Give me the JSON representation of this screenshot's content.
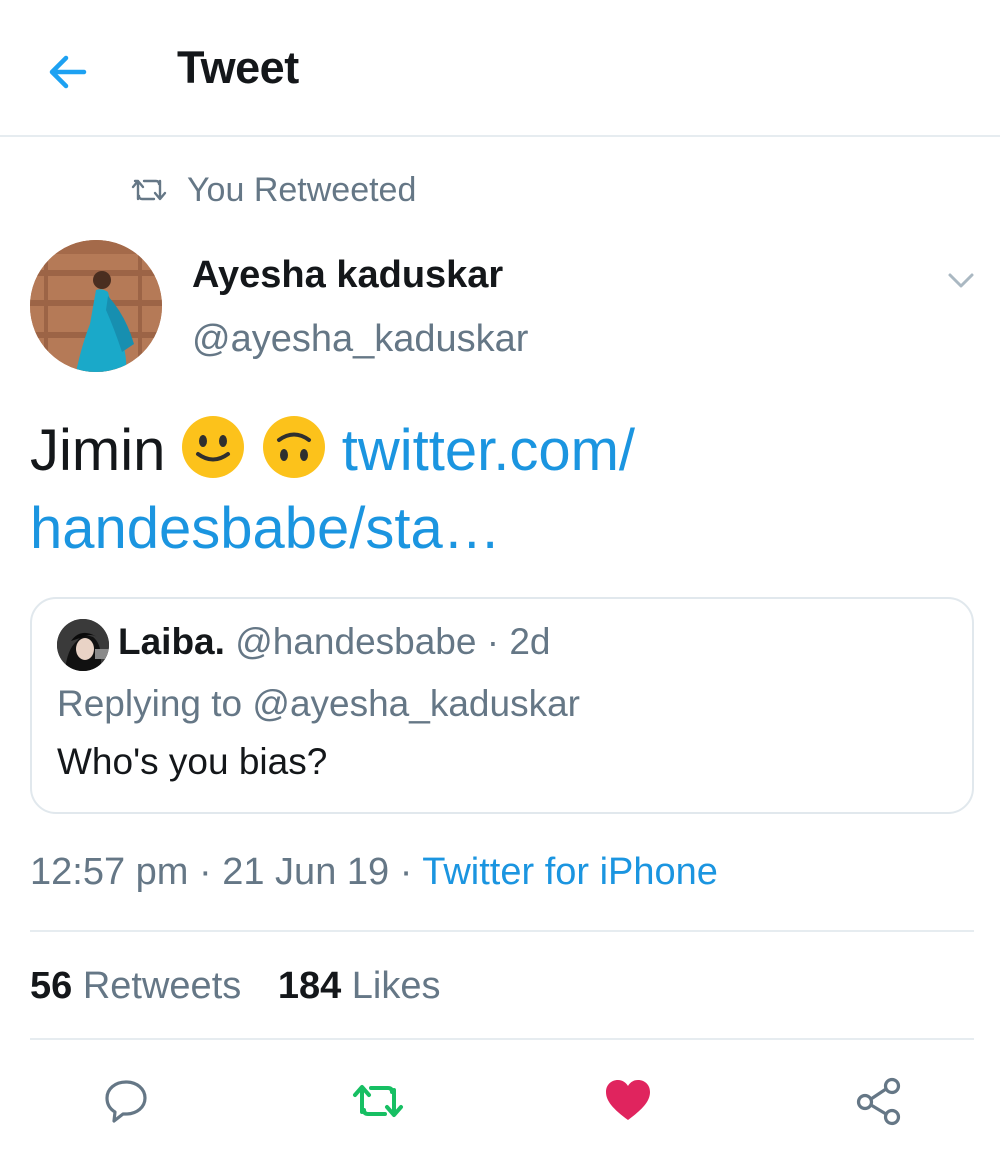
{
  "header": {
    "title": "Tweet",
    "back_icon": "arrow-left-icon"
  },
  "social_context": {
    "label": "You Retweeted",
    "icon": "retweet-icon"
  },
  "tweet": {
    "author_name": "Ayesha kaduskar",
    "author_handle": "@ayesha_kaduskar",
    "text": "Jimin",
    "emojis": [
      "slightly-smiling-face-icon",
      "upside-down-face-icon"
    ],
    "link_line1": "twitter.com/",
    "link_line2": "handesbabe/sta…",
    "timestamp": "12:57 pm",
    "date": "21 Jun 19",
    "source": "Twitter for iPhone"
  },
  "quote": {
    "name": "Laiba.",
    "handle": "@handesbabe",
    "age": "2d",
    "replying_prefix": "Replying to",
    "replying_to": "@ayesha_kaduskar",
    "text": "Who's you bias?"
  },
  "stats": {
    "retweets_count": "56",
    "retweets_label": "Retweets",
    "likes_count": "184",
    "likes_label": "Likes"
  },
  "colors": {
    "accent": "#1b95e0",
    "retweet_active": "#17bf63",
    "like_active": "#e0245e",
    "secondary_text": "#657786",
    "divider": "#e6ecf0"
  }
}
